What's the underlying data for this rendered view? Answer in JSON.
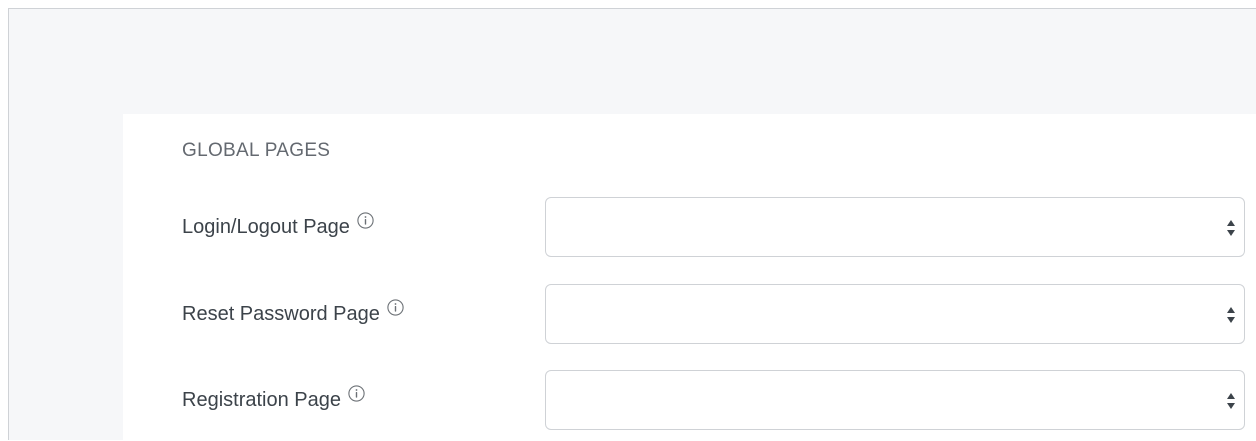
{
  "section": {
    "heading": "GLOBAL PAGES"
  },
  "fields": [
    {
      "label": "Login/Logout Page",
      "value": "",
      "icon": "info-icon"
    },
    {
      "label": "Reset Password Page",
      "value": "",
      "icon": "info-icon"
    },
    {
      "label": "Registration Page",
      "value": "",
      "icon": "info-icon"
    }
  ],
  "colors": {
    "frame_background": "#f6f7f9",
    "panel_background": "#ffffff",
    "heading_text": "#646970",
    "label_text": "#3c434a",
    "border": "#cfd2d6"
  }
}
